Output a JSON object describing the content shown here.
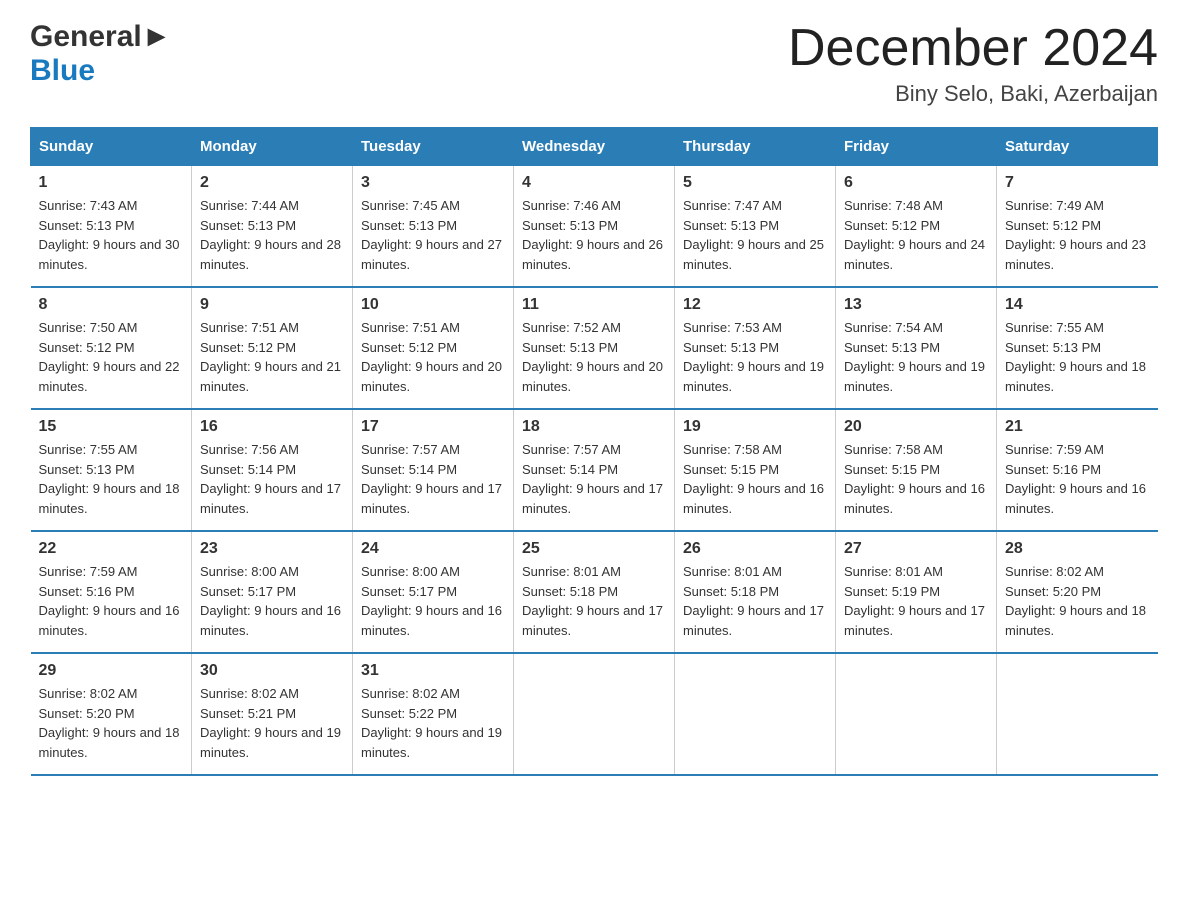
{
  "header": {
    "logo_general": "General",
    "logo_blue": "Blue",
    "month_title": "December 2024",
    "location": "Biny Selo, Baki, Azerbaijan"
  },
  "days_of_week": [
    "Sunday",
    "Monday",
    "Tuesday",
    "Wednesday",
    "Thursday",
    "Friday",
    "Saturday"
  ],
  "weeks": [
    [
      {
        "day": "1",
        "sunrise": "7:43 AM",
        "sunset": "5:13 PM",
        "daylight": "9 hours and 30 minutes."
      },
      {
        "day": "2",
        "sunrise": "7:44 AM",
        "sunset": "5:13 PM",
        "daylight": "9 hours and 28 minutes."
      },
      {
        "day": "3",
        "sunrise": "7:45 AM",
        "sunset": "5:13 PM",
        "daylight": "9 hours and 27 minutes."
      },
      {
        "day": "4",
        "sunrise": "7:46 AM",
        "sunset": "5:13 PM",
        "daylight": "9 hours and 26 minutes."
      },
      {
        "day": "5",
        "sunrise": "7:47 AM",
        "sunset": "5:13 PM",
        "daylight": "9 hours and 25 minutes."
      },
      {
        "day": "6",
        "sunrise": "7:48 AM",
        "sunset": "5:12 PM",
        "daylight": "9 hours and 24 minutes."
      },
      {
        "day": "7",
        "sunrise": "7:49 AM",
        "sunset": "5:12 PM",
        "daylight": "9 hours and 23 minutes."
      }
    ],
    [
      {
        "day": "8",
        "sunrise": "7:50 AM",
        "sunset": "5:12 PM",
        "daylight": "9 hours and 22 minutes."
      },
      {
        "day": "9",
        "sunrise": "7:51 AM",
        "sunset": "5:12 PM",
        "daylight": "9 hours and 21 minutes."
      },
      {
        "day": "10",
        "sunrise": "7:51 AM",
        "sunset": "5:12 PM",
        "daylight": "9 hours and 20 minutes."
      },
      {
        "day": "11",
        "sunrise": "7:52 AM",
        "sunset": "5:13 PM",
        "daylight": "9 hours and 20 minutes."
      },
      {
        "day": "12",
        "sunrise": "7:53 AM",
        "sunset": "5:13 PM",
        "daylight": "9 hours and 19 minutes."
      },
      {
        "day": "13",
        "sunrise": "7:54 AM",
        "sunset": "5:13 PM",
        "daylight": "9 hours and 19 minutes."
      },
      {
        "day": "14",
        "sunrise": "7:55 AM",
        "sunset": "5:13 PM",
        "daylight": "9 hours and 18 minutes."
      }
    ],
    [
      {
        "day": "15",
        "sunrise": "7:55 AM",
        "sunset": "5:13 PM",
        "daylight": "9 hours and 18 minutes."
      },
      {
        "day": "16",
        "sunrise": "7:56 AM",
        "sunset": "5:14 PM",
        "daylight": "9 hours and 17 minutes."
      },
      {
        "day": "17",
        "sunrise": "7:57 AM",
        "sunset": "5:14 PM",
        "daylight": "9 hours and 17 minutes."
      },
      {
        "day": "18",
        "sunrise": "7:57 AM",
        "sunset": "5:14 PM",
        "daylight": "9 hours and 17 minutes."
      },
      {
        "day": "19",
        "sunrise": "7:58 AM",
        "sunset": "5:15 PM",
        "daylight": "9 hours and 16 minutes."
      },
      {
        "day": "20",
        "sunrise": "7:58 AM",
        "sunset": "5:15 PM",
        "daylight": "9 hours and 16 minutes."
      },
      {
        "day": "21",
        "sunrise": "7:59 AM",
        "sunset": "5:16 PM",
        "daylight": "9 hours and 16 minutes."
      }
    ],
    [
      {
        "day": "22",
        "sunrise": "7:59 AM",
        "sunset": "5:16 PM",
        "daylight": "9 hours and 16 minutes."
      },
      {
        "day": "23",
        "sunrise": "8:00 AM",
        "sunset": "5:17 PM",
        "daylight": "9 hours and 16 minutes."
      },
      {
        "day": "24",
        "sunrise": "8:00 AM",
        "sunset": "5:17 PM",
        "daylight": "9 hours and 16 minutes."
      },
      {
        "day": "25",
        "sunrise": "8:01 AM",
        "sunset": "5:18 PM",
        "daylight": "9 hours and 17 minutes."
      },
      {
        "day": "26",
        "sunrise": "8:01 AM",
        "sunset": "5:18 PM",
        "daylight": "9 hours and 17 minutes."
      },
      {
        "day": "27",
        "sunrise": "8:01 AM",
        "sunset": "5:19 PM",
        "daylight": "9 hours and 17 minutes."
      },
      {
        "day": "28",
        "sunrise": "8:02 AM",
        "sunset": "5:20 PM",
        "daylight": "9 hours and 18 minutes."
      }
    ],
    [
      {
        "day": "29",
        "sunrise": "8:02 AM",
        "sunset": "5:20 PM",
        "daylight": "9 hours and 18 minutes."
      },
      {
        "day": "30",
        "sunrise": "8:02 AM",
        "sunset": "5:21 PM",
        "daylight": "9 hours and 19 minutes."
      },
      {
        "day": "31",
        "sunrise": "8:02 AM",
        "sunset": "5:22 PM",
        "daylight": "9 hours and 19 minutes."
      },
      {
        "day": "",
        "sunrise": "",
        "sunset": "",
        "daylight": ""
      },
      {
        "day": "",
        "sunrise": "",
        "sunset": "",
        "daylight": ""
      },
      {
        "day": "",
        "sunrise": "",
        "sunset": "",
        "daylight": ""
      },
      {
        "day": "",
        "sunrise": "",
        "sunset": "",
        "daylight": ""
      }
    ]
  ],
  "labels": {
    "sunrise_prefix": "Sunrise: ",
    "sunset_prefix": "Sunset: ",
    "daylight_prefix": "Daylight: "
  }
}
